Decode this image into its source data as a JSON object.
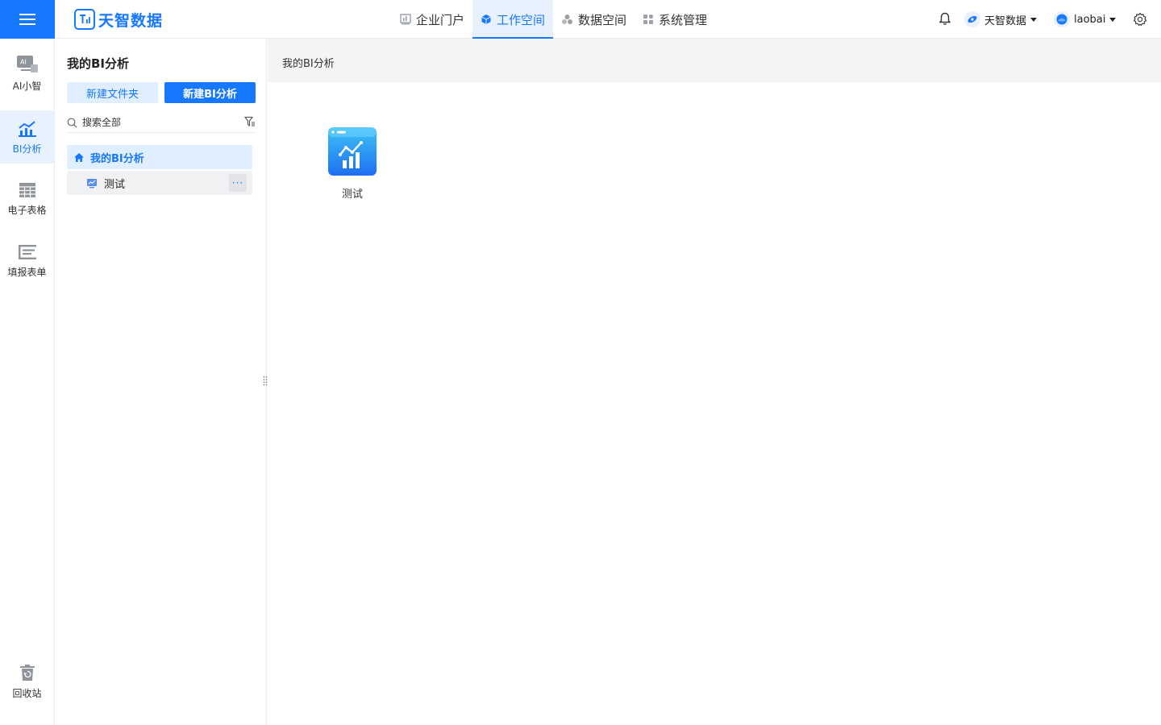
{
  "brand": {
    "name": "天智数据",
    "color": "#1677ff"
  },
  "nav": [
    {
      "label": "企业门户",
      "icon": "chart-icon",
      "active": false
    },
    {
      "label": "工作空间",
      "icon": "cube-icon",
      "active": true
    },
    {
      "label": "数据空间",
      "icon": "cluster-icon",
      "active": false
    },
    {
      "label": "系统管理",
      "icon": "grid-icon",
      "active": false
    }
  ],
  "top_right": {
    "org_label": "天智数据",
    "user_label": "laobai"
  },
  "rail": [
    {
      "label": "AI小智",
      "icon": "ai-monitor-icon",
      "active": false
    },
    {
      "label": "BI分析",
      "icon": "bar-chart-icon",
      "active": true
    },
    {
      "label": "电子表格",
      "icon": "table-icon",
      "active": false
    },
    {
      "label": "填报表单",
      "icon": "form-icon",
      "active": false
    }
  ],
  "recycle": {
    "label": "回收站",
    "icon": "recycle-icon"
  },
  "panel": {
    "title": "我的BI分析",
    "new_folder_label": "新建文件夹",
    "new_bi_label": "新建BI分析",
    "search_placeholder": "搜索全部",
    "tree": {
      "root_label": "我的BI分析",
      "children": [
        {
          "label": "测试",
          "more": "···"
        }
      ]
    }
  },
  "main": {
    "breadcrumb": "我的BI分析",
    "files": [
      {
        "name": "测试",
        "icon": "bi-report-icon"
      }
    ]
  }
}
